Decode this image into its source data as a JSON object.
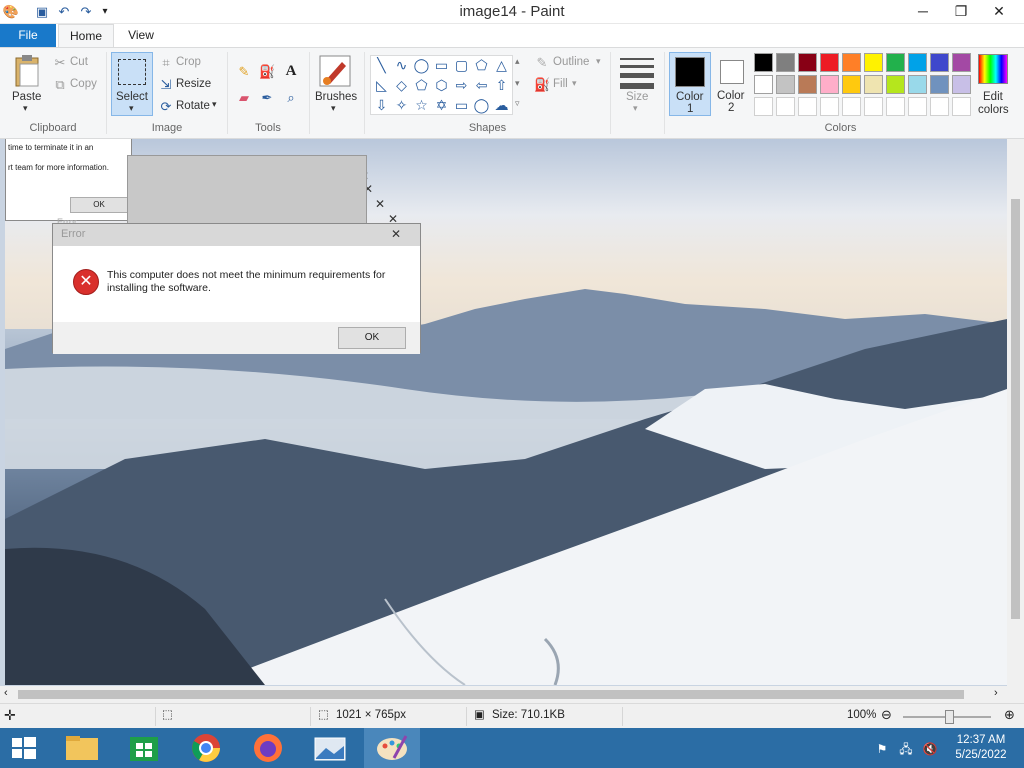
{
  "window": {
    "title": "image14 - Paint"
  },
  "tabs": {
    "file": "File",
    "home": "Home",
    "view": "View"
  },
  "ribbon": {
    "clipboard": {
      "paste": "Paste",
      "cut": "Cut",
      "copy": "Copy",
      "label": "Clipboard"
    },
    "image": {
      "select": "Select",
      "crop": "Crop",
      "resize": "Resize",
      "rotate": "Rotate",
      "label": "Image"
    },
    "tools": {
      "label": "Tools"
    },
    "brushes": {
      "label": "Brushes"
    },
    "shapes": {
      "outline": "Outline",
      "fill": "Fill",
      "label": "Shapes"
    },
    "size": {
      "label": "Size"
    },
    "colors": {
      "color1": "Color 1",
      "color1_a": "Color",
      "color1_b": "1",
      "color2_a": "Color",
      "color2_b": "2",
      "edit_a": "Edit",
      "edit_b": "colors",
      "label": "Colors",
      "palette": [
        "#000000",
        "#7f7f7f",
        "#880015",
        "#ed1c24",
        "#ff7f27",
        "#fff200",
        "#22b14c",
        "#00a2e8",
        "#3f48cc",
        "#a349a4",
        "#ffffff",
        "#c3c3c3",
        "#b97a57",
        "#ffaec9",
        "#ffc90e",
        "#efe4b0",
        "#b5e61d",
        "#99d9ea",
        "#7092be",
        "#c8bfe7"
      ]
    }
  },
  "dialogs": {
    "back": {
      "line1": "time to terminate it in an",
      "line2": "rt team for more information.",
      "ok": "OK",
      "title": "Error"
    },
    "front": {
      "title": "Error",
      "message": "This computer does not meet the minimum requirements for installing the software.",
      "ok": "OK"
    }
  },
  "status": {
    "dimensions": "1021 × 765px",
    "size": "Size: 710.1KB",
    "zoom": "100%"
  },
  "taskbar": {
    "time": "12:37 AM",
    "date": "5/25/2022"
  }
}
